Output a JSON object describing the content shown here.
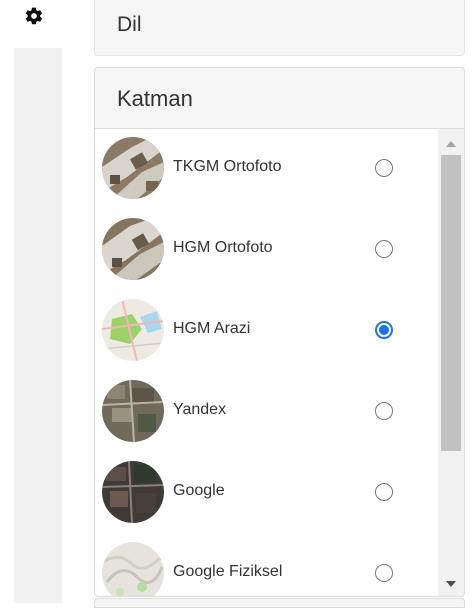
{
  "sections": {
    "dil": {
      "title": "Dil"
    },
    "katman": {
      "title": "Katman"
    }
  },
  "layers": [
    {
      "label": "TKGM Ortofoto",
      "selected": false,
      "thumb": "aerial-photo"
    },
    {
      "label": "HGM Ortofoto",
      "selected": false,
      "thumb": "aerial-photo"
    },
    {
      "label": "HGM Arazi",
      "selected": true,
      "thumb": "terrain-map"
    },
    {
      "label": "Yandex",
      "selected": false,
      "thumb": "satellite"
    },
    {
      "label": "Google",
      "selected": false,
      "thumb": "satellite-dark"
    },
    {
      "label": "Google Fiziksel",
      "selected": false,
      "thumb": "physical-map"
    }
  ],
  "icons": {
    "settings": "gear-icon"
  },
  "colors": {
    "accent": "#1a73e8",
    "panel_header": "#f5f5f5"
  }
}
